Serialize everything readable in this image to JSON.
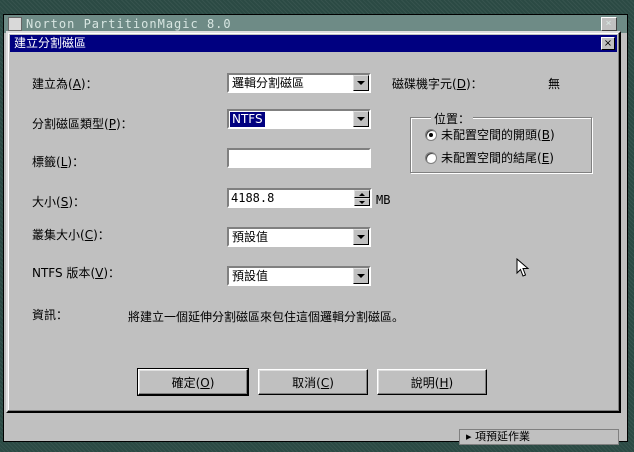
{
  "background_window": {
    "title": "Norton PartitionMagic 8.0",
    "close_glyph": "×",
    "bottom_strip_text": "▸ 項預延作業"
  },
  "dialog": {
    "title": "建立分割磁區",
    "close_glyph": "×"
  },
  "create_as": {
    "label": "建立為",
    "hotkey": "A",
    "value": "邏輯分割磁區"
  },
  "drive_letter": {
    "label": "磁碟機字元",
    "hotkey": "D",
    "value": "無"
  },
  "partition_type": {
    "label": "分割磁區類型",
    "hotkey": "P",
    "value": "NTFS"
  },
  "volume_label": {
    "label": "標籤",
    "hotkey": "L",
    "value": ""
  },
  "size": {
    "label": "大小",
    "hotkey": "S",
    "value": "4188.8",
    "unit": "MB"
  },
  "cluster_size": {
    "label": "叢集大小",
    "hotkey": "C",
    "value": "預設值"
  },
  "ntfs_version": {
    "label": "NTFS 版本",
    "hotkey": "V",
    "value": "預設值"
  },
  "position": {
    "title": "位置：",
    "options": [
      {
        "label": "未配置空間的開頭",
        "hotkey": "B",
        "selected": true
      },
      {
        "label": "未配置空間的結尾",
        "hotkey": "E",
        "selected": false
      }
    ]
  },
  "info": {
    "label": "資訊：",
    "text": "將建立一個延伸分割磁區來包住這個邏輯分割磁區。"
  },
  "buttons": {
    "ok": {
      "label": "確定",
      "hotkey": "O"
    },
    "cancel": {
      "label": "取消",
      "hotkey": "C"
    },
    "help": {
      "label": "說明",
      "hotkey": "H"
    }
  },
  "punct": {
    "open": "(",
    "close": ")",
    "colon": "："
  }
}
